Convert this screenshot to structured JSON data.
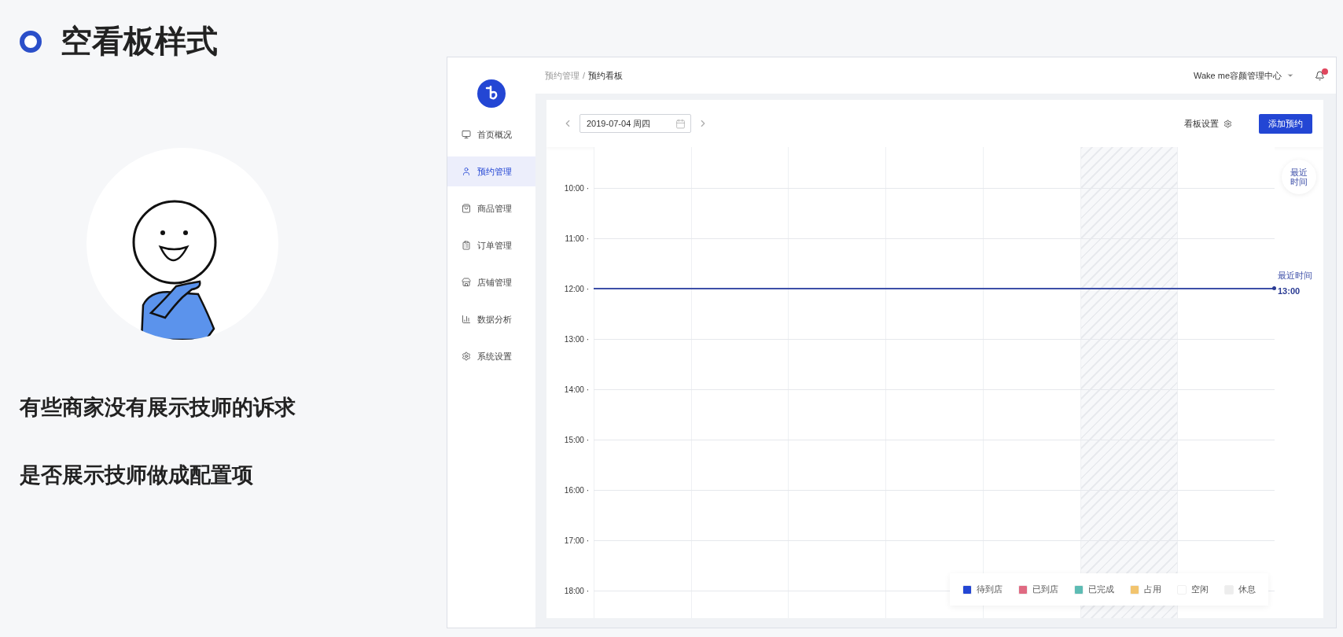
{
  "slide": {
    "title": "空看板样式",
    "points": [
      "有些商家没有展示技师的诉求",
      "是否展示技师做成配置项"
    ]
  },
  "app": {
    "breadcrumb": [
      {
        "label": "预约管理",
        "current": false
      },
      {
        "label": "/",
        "current": false
      },
      {
        "label": "预约看板",
        "current": true
      }
    ],
    "account": "Wake me容颜管理中心",
    "sidebar": [
      {
        "label": "首页概况",
        "selected": false
      },
      {
        "label": "预约管理",
        "selected": true
      },
      {
        "label": "商品管理",
        "selected": false
      },
      {
        "label": "订单管理",
        "selected": false
      },
      {
        "label": "店铺管理",
        "selected": false
      },
      {
        "label": "数据分析",
        "selected": false
      },
      {
        "label": "系统设置",
        "selected": false
      }
    ],
    "toolbar": {
      "date": "2019-07-04 周四",
      "settings": "看板设置",
      "add_button": "添加预约"
    },
    "columns": [
      {
        "resting": false
      },
      {
        "resting": false
      },
      {
        "resting": false
      },
      {
        "resting": false
      },
      {
        "resting": false
      },
      {
        "resting": true
      },
      {
        "resting": false
      }
    ],
    "rows": [
      {
        "time": "10:00 ·",
        "current": false
      },
      {
        "time": "11:00 ·",
        "current": false
      },
      {
        "time": "12:00 ·",
        "current": true
      },
      {
        "time": "13:00 ·",
        "current": false
      },
      {
        "time": "14:00 ·",
        "current": false
      },
      {
        "time": "15:00 ·",
        "current": false
      },
      {
        "time": "16:00 ·",
        "current": false
      },
      {
        "time": "17:00 ·",
        "current": false
      },
      {
        "time": "18:00 ·",
        "current": false
      }
    ],
    "recent_button": "最近时间",
    "now_marker": {
      "label": "最近时间",
      "time": "13:00"
    },
    "legend": [
      {
        "label": "待到店",
        "color": "#2346d4"
      },
      {
        "label": "已到店",
        "color": "#e06a82"
      },
      {
        "label": "已完成",
        "color": "#5dbcb4"
      },
      {
        "label": "占用",
        "color": "#f2c46e"
      },
      {
        "label": "空闲",
        "color": "#ffffff"
      },
      {
        "label": "休息",
        "color": "#ededed"
      }
    ]
  }
}
